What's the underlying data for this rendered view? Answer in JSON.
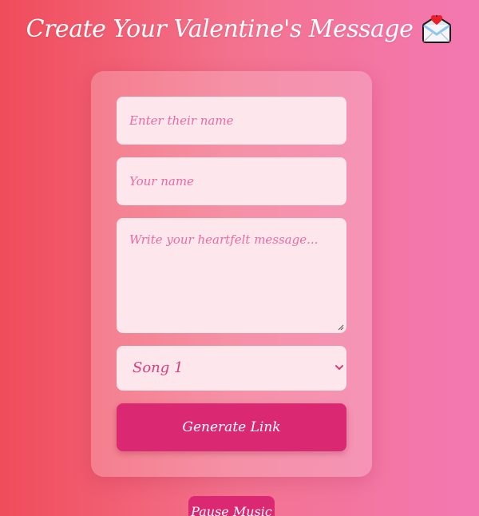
{
  "header": {
    "title": "Create Your Valentine's Message",
    "icon": "love-letter-envelope-icon"
  },
  "form": {
    "recipient_placeholder": "Enter their name",
    "sender_placeholder": "Your name",
    "message_placeholder": "Write your heartfelt message...",
    "song_selected": "Song 1",
    "generate_label": "Generate Link"
  },
  "controls": {
    "pause_music_label": "Pause Music"
  },
  "colors": {
    "gradient_start": "#f04c5a",
    "gradient_end": "#f378b2",
    "accent": "#da2873",
    "field_bg": "#fde6ec",
    "placeholder_text": "#ea6aa3"
  }
}
